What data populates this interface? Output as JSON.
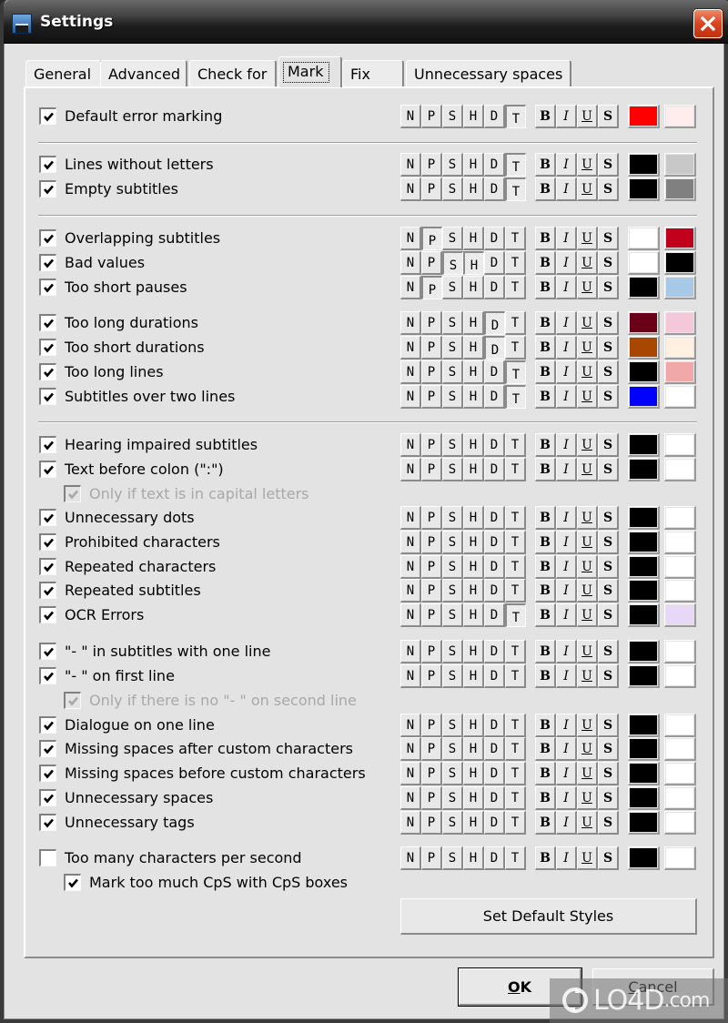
{
  "window": {
    "title": "Settings",
    "close_label": "✕"
  },
  "tabs": [
    {
      "label": "General",
      "active": false
    },
    {
      "label": "Advanced",
      "active": false
    },
    {
      "label": "Check for",
      "active": false
    },
    {
      "label": "Mark",
      "active": true
    },
    {
      "label": "Fix",
      "active": false
    },
    {
      "label": "Unnecessary spaces",
      "active": false
    }
  ],
  "style_buttons": [
    "N",
    "P",
    "S",
    "H",
    "D",
    "T"
  ],
  "format_buttons": [
    "B",
    "I",
    "U",
    "S"
  ],
  "rows": [
    {
      "label": "Default error marking",
      "checked": true,
      "pressed": [
        "T"
      ],
      "fg": "#ff0000",
      "bg": "#ffecec"
    },
    {
      "label": "Lines without letters",
      "checked": true,
      "pressed": [
        "T"
      ],
      "fg": "#000000",
      "bg": "#c8c8c8"
    },
    {
      "label": "Empty subtitles",
      "checked": true,
      "pressed": [
        "T"
      ],
      "fg": "#000000",
      "bg": "#808080"
    },
    {
      "label": "Overlapping subtitles",
      "checked": true,
      "pressed": [
        "P"
      ],
      "fg": "#ffffff",
      "bg": "#c0001c"
    },
    {
      "label": "Bad values",
      "checked": true,
      "pressed": [
        "S",
        "H"
      ],
      "fg": "#ffffff",
      "bg": "#000000"
    },
    {
      "label": "Too short pauses",
      "checked": true,
      "pressed": [
        "P"
      ],
      "fg": "#000000",
      "bg": "#a8c8e8"
    },
    {
      "label": "Too long durations",
      "checked": true,
      "pressed": [
        "D"
      ],
      "fg": "#6a0018",
      "bg": "#f4c8d8"
    },
    {
      "label": "Too short durations",
      "checked": true,
      "pressed": [
        "D"
      ],
      "fg": "#a84800",
      "bg": "#fff0e0"
    },
    {
      "label": "Too long lines",
      "checked": true,
      "pressed": [
        "T"
      ],
      "fg": "#000000",
      "bg": "#f0a8a8"
    },
    {
      "label": "Subtitles over two lines",
      "checked": true,
      "pressed": [
        "T"
      ],
      "fg": "#0000ff",
      "bg": "#ffffff"
    },
    {
      "label": "Hearing impaired subtitles",
      "checked": true,
      "pressed": [],
      "fg": "#000000",
      "bg": "#ffffff"
    },
    {
      "label": "Text before colon (\":\")",
      "checked": true,
      "pressed": [],
      "fg": "#000000",
      "bg": "#ffffff"
    },
    {
      "label": "Only if text is in capital letters",
      "checked": true,
      "sub": true,
      "disabled": true
    },
    {
      "label": "Unnecessary dots",
      "checked": true,
      "pressed": [],
      "fg": "#000000",
      "bg": "#ffffff"
    },
    {
      "label": "Prohibited characters",
      "checked": true,
      "pressed": [],
      "fg": "#000000",
      "bg": "#ffffff"
    },
    {
      "label": "Repeated characters",
      "checked": true,
      "pressed": [],
      "fg": "#000000",
      "bg": "#ffffff"
    },
    {
      "label": "Repeated subtitles",
      "checked": true,
      "pressed": [],
      "fg": "#000000",
      "bg": "#ffffff"
    },
    {
      "label": "OCR Errors",
      "checked": true,
      "pressed": [
        "T"
      ],
      "fg": "#000000",
      "bg": "#e8d8f8"
    },
    {
      "label": "\"- \" in subtitles with one line",
      "checked": true,
      "pressed": [],
      "fg": "#000000",
      "bg": "#ffffff"
    },
    {
      "label": "\"- \" on first line",
      "checked": true,
      "pressed": [],
      "fg": "#000000",
      "bg": "#ffffff"
    },
    {
      "label": "Only if there is no \"- \" on second line",
      "checked": true,
      "sub": true,
      "disabled": true
    },
    {
      "label": "Dialogue on one line",
      "checked": true,
      "pressed": [],
      "fg": "#000000",
      "bg": "#ffffff"
    },
    {
      "label": "Missing spaces after custom characters",
      "checked": true,
      "pressed": [],
      "fg": "#000000",
      "bg": "#ffffff"
    },
    {
      "label": "Missing spaces before custom characters",
      "checked": true,
      "pressed": [],
      "fg": "#000000",
      "bg": "#ffffff"
    },
    {
      "label": "Unnecessary spaces",
      "checked": true,
      "pressed": [],
      "fg": "#000000",
      "bg": "#ffffff"
    },
    {
      "label": "Unnecessary tags",
      "checked": true,
      "pressed": [],
      "fg": "#000000",
      "bg": "#ffffff"
    },
    {
      "label": "Too many characters per second",
      "checked": false,
      "pressed": [],
      "fg": "#000000",
      "bg": "#ffffff"
    },
    {
      "label": "Mark too much CpS with CpS boxes",
      "checked": true,
      "sub": true,
      "disabled": false
    }
  ],
  "buttons": {
    "set_default_styles": "Set Default Styles",
    "ok": "OK",
    "ok_mnemonic": "O",
    "ok_rest": "K",
    "cancel": "Cancel",
    "cancel_mnemonic": "C",
    "cancel_rest": "ancel"
  },
  "watermark": {
    "text": "LO4D",
    "suffix": ".com"
  }
}
